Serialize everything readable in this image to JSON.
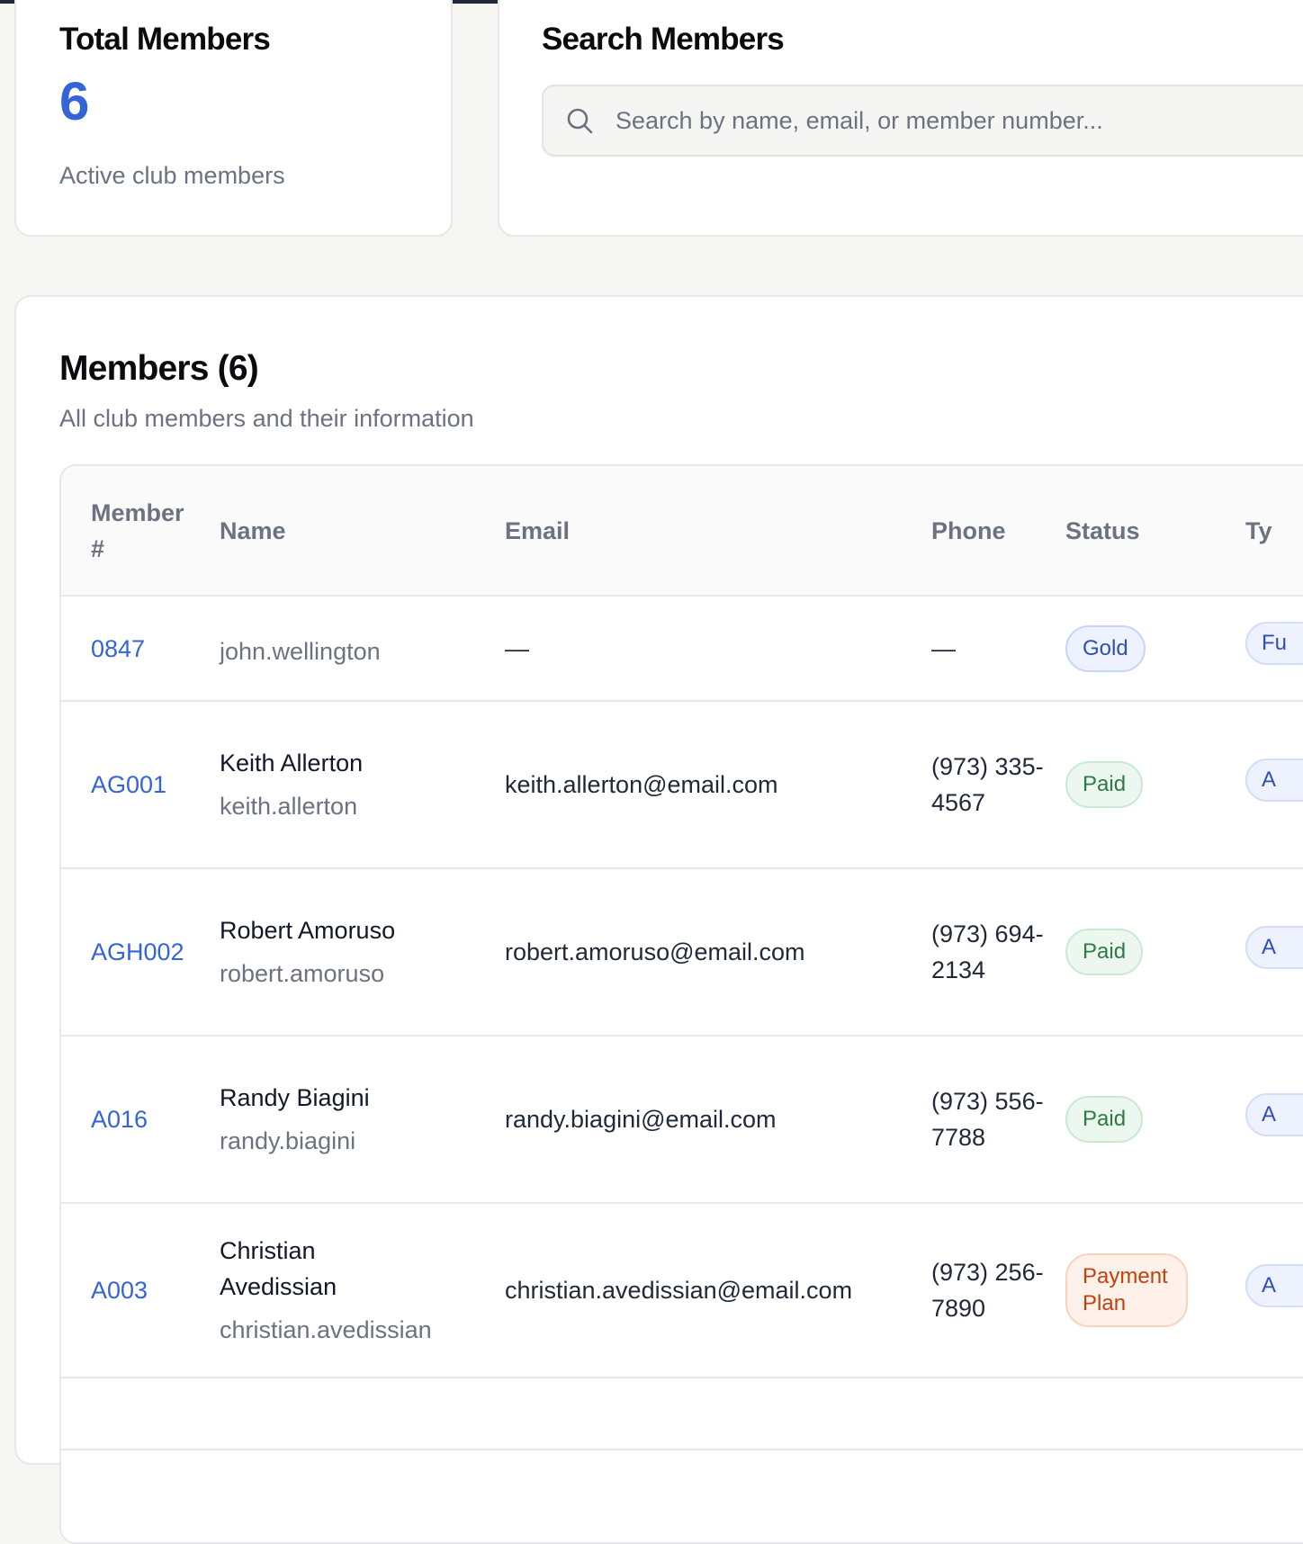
{
  "summary": {
    "title": "Total Members",
    "count": "6",
    "subtitle": "Active club members"
  },
  "search": {
    "title": "Search Members",
    "placeholder": "Search by name, email, or member number..."
  },
  "members": {
    "title": "Members (6)",
    "subtitle": "All club members and their information",
    "columns": {
      "member_number": "Member #",
      "name": "Name",
      "email": "Email",
      "phone": "Phone",
      "status": "Status",
      "type": "Ty"
    },
    "rows": [
      {
        "member_number": "0847",
        "name": "",
        "username": "john.wellington",
        "email": "—",
        "phone": "—",
        "status": "Gold",
        "type": "Fu"
      },
      {
        "member_number": "AG001",
        "name": "Keith Allerton",
        "username": "keith.allerton",
        "email": "keith.allerton@email.com",
        "phone": "(973) 335-4567",
        "status": "Paid",
        "type": "A"
      },
      {
        "member_number": "AGH002",
        "name": "Robert Amoruso",
        "username": "robert.amoruso",
        "email": "robert.amoruso@email.com",
        "phone": "(973) 694-2134",
        "status": "Paid",
        "type": "A"
      },
      {
        "member_number": "A016",
        "name": "Randy Biagini",
        "username": "randy.biagini",
        "email": "randy.biagini@email.com",
        "phone": "(973) 556-7788",
        "status": "Paid",
        "type": "A"
      },
      {
        "member_number": "A003",
        "name": "Christian Avedissian",
        "username": "christian.avedissian",
        "email": "christian.avedissian@email.com",
        "phone": "(973) 256-7890",
        "status": "Payment Plan",
        "type": "A"
      }
    ]
  },
  "colors": {
    "accent": "#3563d8",
    "gold_badge": "#2f4fb2",
    "paid_badge": "#2f7a43",
    "plan_badge": "#c2410c",
    "background": "#f6f6f3"
  },
  "icons": {
    "search": "search-icon"
  }
}
